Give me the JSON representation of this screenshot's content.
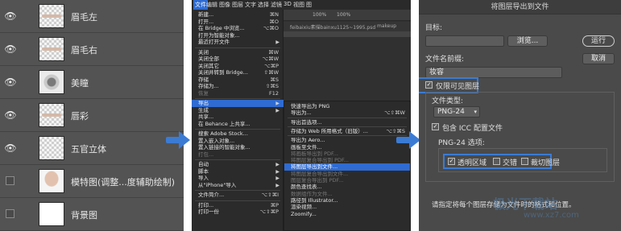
{
  "layers_panel": {
    "layers": [
      {
        "name": "眉毛左",
        "visible": true,
        "thumb": "strip"
      },
      {
        "name": "眉毛右",
        "visible": true,
        "thumb": "strip"
      },
      {
        "name": "美瞳",
        "visible": true,
        "thumb": "eye-img"
      },
      {
        "name": "唇彩",
        "visible": true,
        "thumb": "strip"
      },
      {
        "name": "五官立体",
        "visible": true,
        "thumb": "checker"
      },
      {
        "name": "模特图(调整...度辅助绘制)",
        "visible": false,
        "thumb": "face"
      },
      {
        "name": "背景图",
        "visible": false,
        "thumb": "white"
      }
    ],
    "eye_glyph": "👁"
  },
  "photoshop": {
    "menubar": [
      "文件",
      "编辑",
      "图像",
      "图层",
      "文字",
      "选择",
      "滤镜",
      "3D",
      "视图",
      "图"
    ],
    "active_menu": "文件",
    "toolbar": {
      "zoom_a": "100%",
      "zoom_b": "100%"
    },
    "tabs": [
      "feibaixiu素描bainxu1125~1995.psd",
      "makeup"
    ],
    "file_menu": [
      {
        "label": "新建...",
        "shortcut": "⌘N"
      },
      {
        "label": "打开...",
        "shortcut": "⌘O"
      },
      {
        "label": "在 Bridge 中浏览...",
        "shortcut": "⌥⌘O"
      },
      {
        "label": "打开为智能对象...",
        "shortcut": ""
      },
      {
        "label": "最近打开文件",
        "shortcut": "",
        "submenu": true
      },
      {
        "sep": true
      },
      {
        "label": "关闭",
        "shortcut": "⌘W"
      },
      {
        "label": "关闭全部",
        "shortcut": "⌥⌘W"
      },
      {
        "label": "关闭其它",
        "shortcut": "⌥⌘P"
      },
      {
        "label": "关闭并转到 Bridge...",
        "shortcut": "⇧⌘W"
      },
      {
        "label": "存储",
        "shortcut": "⌘S"
      },
      {
        "label": "存储为...",
        "shortcut": "⇧⌘S"
      },
      {
        "label": "恢复",
        "shortcut": "F12",
        "dim": true
      },
      {
        "sep": true
      },
      {
        "label": "导出",
        "shortcut": "",
        "submenu": true,
        "highlight": true
      },
      {
        "label": "生成",
        "shortcut": "",
        "submenu": true
      },
      {
        "label": "共享...",
        "shortcut": ""
      },
      {
        "label": "在 Behance 上共享...",
        "shortcut": ""
      },
      {
        "sep": true
      },
      {
        "label": "搜索 Adobe Stock...",
        "shortcut": ""
      },
      {
        "label": "置入嵌入对象...",
        "shortcut": ""
      },
      {
        "label": "置入链接的智能对象...",
        "shortcut": ""
      },
      {
        "label": "打包...",
        "shortcut": "",
        "dim": true
      },
      {
        "sep": true
      },
      {
        "label": "自动",
        "shortcut": "",
        "submenu": true
      },
      {
        "label": "脚本",
        "shortcut": "",
        "submenu": true
      },
      {
        "label": "导入",
        "shortcut": "",
        "submenu": true
      },
      {
        "label": "从\"iPhone\"导入",
        "shortcut": "",
        "submenu": true
      },
      {
        "sep": true
      },
      {
        "label": "文件简介...",
        "shortcut": "⌥⇧⌘I"
      },
      {
        "sep": true
      },
      {
        "label": "打印...",
        "shortcut": "⌘P"
      },
      {
        "label": "打印一份",
        "shortcut": "⌥⇧⌘P"
      }
    ],
    "export_submenu": [
      {
        "label": "快速导出为 PNG",
        "shortcut": ""
      },
      {
        "label": "导出为...",
        "shortcut": "⌥⇧⌘W"
      },
      {
        "sep": true
      },
      {
        "label": "导出首选项...",
        "shortcut": ""
      },
      {
        "sep": true
      },
      {
        "label": "存储为 Web 所用格式（旧版）...",
        "shortcut": "⌥⇧⌘S"
      },
      {
        "sep": true
      },
      {
        "label": "导出为 Aero...",
        "shortcut": ""
      },
      {
        "label": "画板至文件...",
        "shortcut": ""
      },
      {
        "label": "将画板导出到 PDF...",
        "shortcut": "",
        "dim": true
      },
      {
        "label": "将图层复合导出到 PDF...",
        "shortcut": "",
        "dim": true
      },
      {
        "label": "将图层导出到文件...",
        "shortcut": "",
        "highlight": true
      },
      {
        "label": "将图层复合导出到文件...",
        "shortcut": "",
        "dim": true
      },
      {
        "label": "图层复合导出到 PDF...",
        "shortcut": "",
        "dim": true
      },
      {
        "label": "颜色查找表...",
        "shortcut": ""
      },
      {
        "label": "数据组作为文件...",
        "shortcut": "",
        "dim": true
      },
      {
        "label": "路径到 Illustrator...",
        "shortcut": ""
      },
      {
        "label": "渲染视频...",
        "shortcut": ""
      },
      {
        "label": "Zoomify...",
        "shortcut": ""
      }
    ]
  },
  "dialog": {
    "title": "将图层导出到文件",
    "target_label": "目标:",
    "browse_button": "浏览...",
    "run_button": "运行",
    "cancel_button": "取消",
    "prefix_label": "文件名前缀:",
    "prefix_value": "妆容",
    "visible_only_label": "仅限可见图层",
    "visible_only_checked": true,
    "file_type_label": "文件类型:",
    "file_type_value": "PNG-24",
    "icc_label": "包含 ICC 配置文件",
    "icc_checked": true,
    "options_label": "PNG-24 选项:",
    "transparency_label": "透明区域",
    "transparency_checked": true,
    "interlaced_label": "交错",
    "interlaced_checked": false,
    "trim_label": "裁切图层",
    "trim_checked": false,
    "footer_text": "请指定将每个图层存储为文件时的格式和位置。",
    "watermark_1": "极光下载站",
    "watermark_2": "www.xz7.com",
    "highlight_color": "#3b7bd4"
  }
}
